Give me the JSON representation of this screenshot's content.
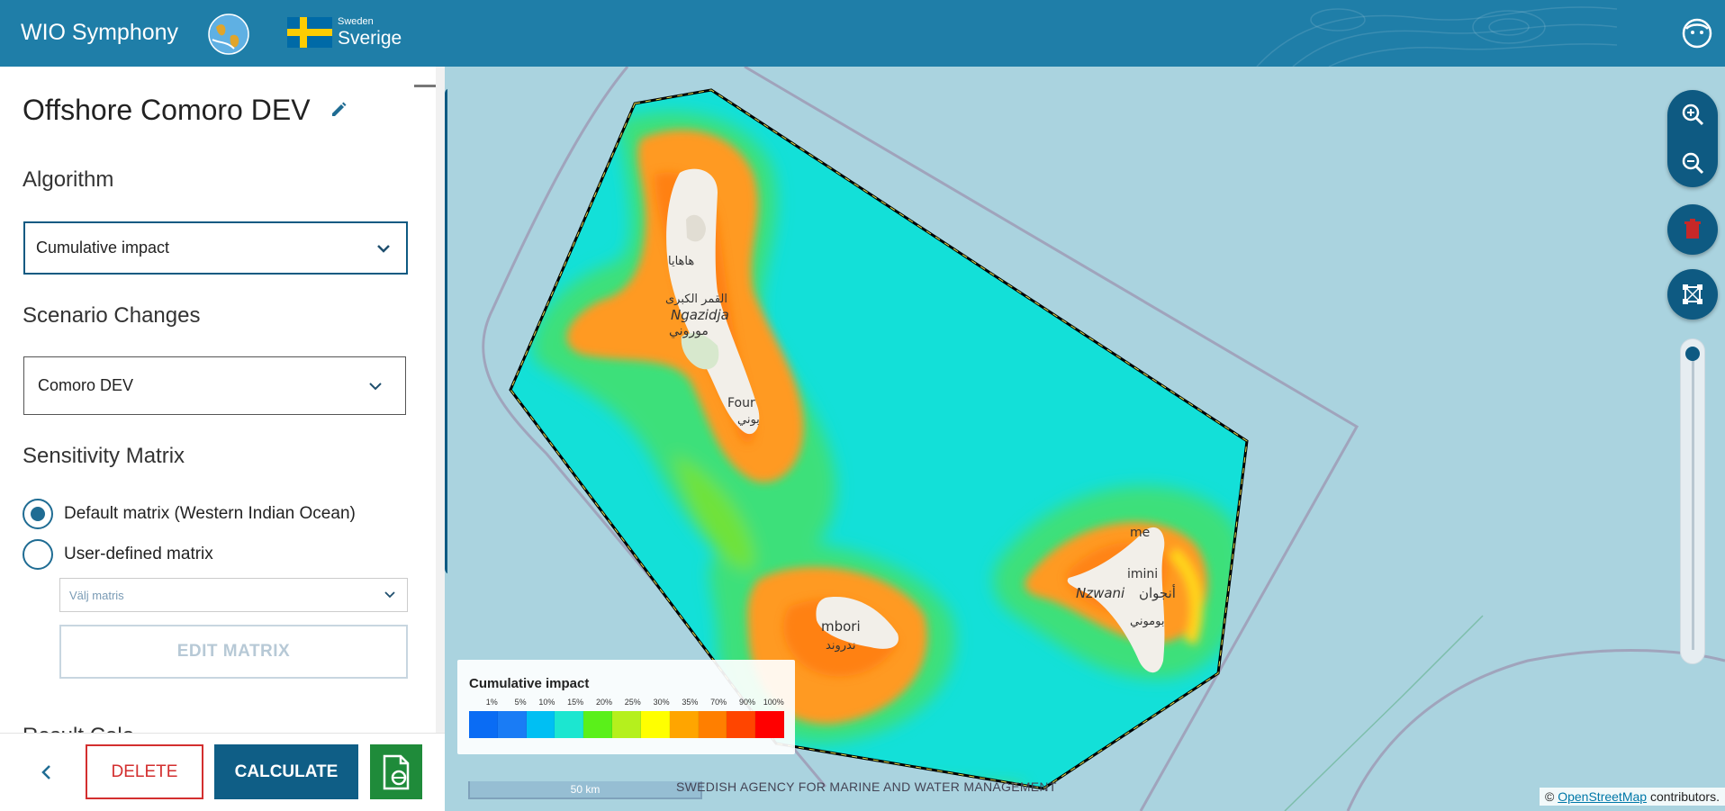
{
  "header": {
    "app_title": "WIO Symphony",
    "country_small": "Sweden",
    "country_big": "Sverige",
    "colors": {
      "header_bg": "#1f7ea8",
      "primary": "#0e5a82"
    }
  },
  "panel": {
    "scenario_title": "Offshore Comoro DEV",
    "algorithm_label": "Algorithm",
    "algorithm_value": "Cumulative impact",
    "scenario_changes_label": "Scenario Changes",
    "scenario_changes_value": "Comoro DEV",
    "sensitivity_label": "Sensitivity Matrix",
    "matrix_options": [
      {
        "label": "Default matrix (Western Indian Ocean)",
        "checked": true
      },
      {
        "label": "User-defined matrix",
        "checked": false
      }
    ],
    "matrix_select_placeholder": "Välj matris",
    "edit_matrix_label": "EDIT MATRIX",
    "cut_label": "Result Colo"
  },
  "footer": {
    "delete_label": "DELETE",
    "calculate_label": "CALCULATE"
  },
  "toolstrip": {
    "tools": [
      "globe-icon",
      "fish-icon",
      "person-icon",
      "calculator-icon",
      "report-icon",
      "matrix-icon"
    ],
    "active": "calculator-icon"
  },
  "map": {
    "place_labels": [
      "هاهايا",
      "القمر الكبرى",
      "Ngazidja",
      "موروني",
      "Four",
      "بوني",
      "mbori",
      "ندروند",
      "me",
      "imini",
      "Nzwani",
      "أنجوان",
      "بوموني"
    ],
    "legend": {
      "title": "Cumulative impact",
      "ticks": [
        "1%",
        "5%",
        "10%",
        "15%",
        "20%",
        "25%",
        "30%",
        "35%",
        "70%",
        "90%",
        "100%"
      ],
      "colors": [
        "#0a6cf4",
        "#1a7cf5",
        "#00bff3",
        "#1ce6d0",
        "#5af01a",
        "#b5f01d",
        "#ffff00",
        "#ffa500",
        "#ff7f00",
        "#ff4500",
        "#ff0000"
      ]
    },
    "scale_label": "50 km",
    "agency_label": "SWEDISH AGENCY FOR MARINE AND WATER MANAGEMENT",
    "attribution_prefix": "©",
    "attribution_link": "OpenStreetMap",
    "attribution_suffix": "contributors.",
    "controls": [
      "zoom-in-icon",
      "zoom-out-icon",
      "trash-icon",
      "polygon-edit-icon"
    ]
  }
}
